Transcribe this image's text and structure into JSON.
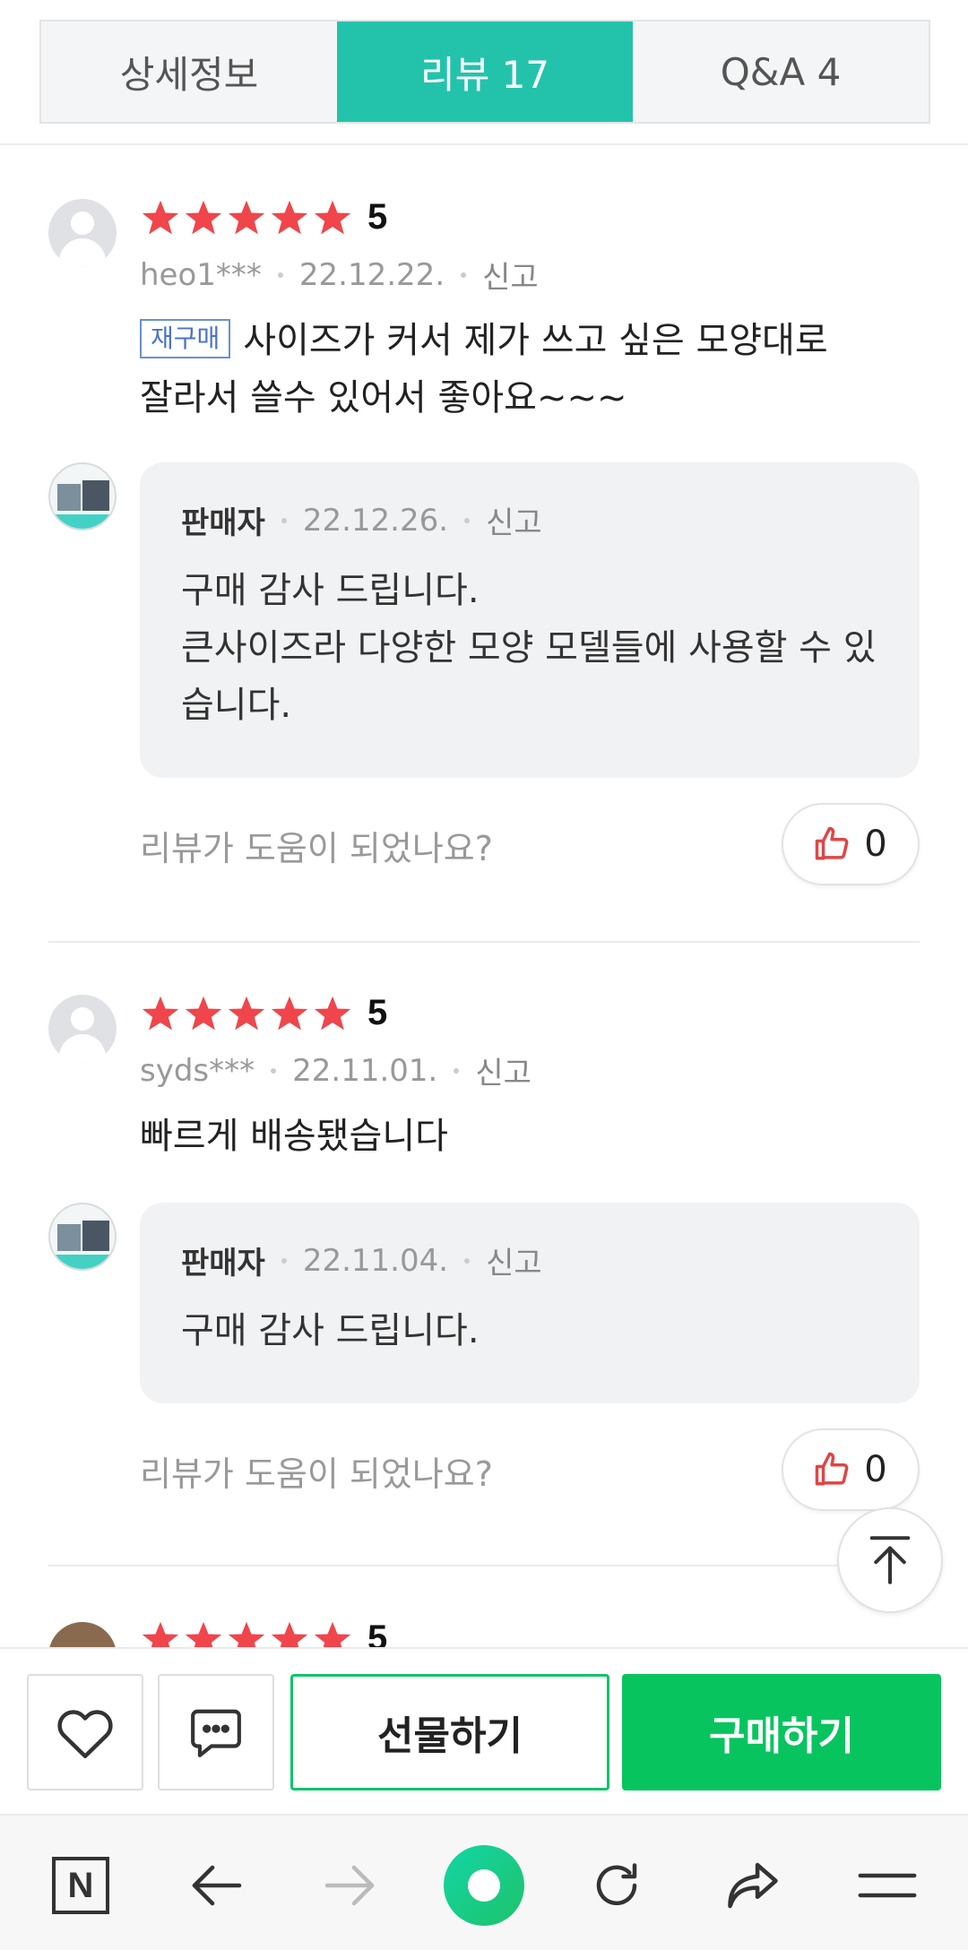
{
  "tabs": [
    {
      "label": "상세정보"
    },
    {
      "label": "리뷰  17"
    },
    {
      "label": "Q&A  4"
    }
  ],
  "reviews": [
    {
      "score": "5",
      "user": "heo1***",
      "date": "22.12.22.",
      "report": "신고",
      "badge": "재구매",
      "text_line1": "사이즈가 커서 제가 쓰고 싶은 모양대로",
      "text_line2": "잘라서 쓸수 있어서 좋아요~~~",
      "reply": {
        "seller": "판매자",
        "date": "22.12.26.",
        "report": "신고",
        "text": "구매 감사 드립니다.\n큰사이즈라 다양한 모양 모델들에 사용할 수 있습니다."
      },
      "helpful_prompt": "리뷰가 도움이 되었나요?",
      "likes": "0"
    },
    {
      "score": "5",
      "user": "syds***",
      "date": "22.11.01.",
      "report": "신고",
      "text": "빠르게 배송됐습니다",
      "reply": {
        "seller": "판매자",
        "date": "22.11.04.",
        "report": "신고",
        "text": "구매 감사 드립니다."
      },
      "helpful_prompt": "리뷰가 도움이 되었나요?",
      "likes": "0"
    },
    {
      "score": "5"
    }
  ],
  "buy_bar": {
    "gift_label": "선물하기",
    "buy_label": "구매하기"
  },
  "nav": {
    "n_logo": "N"
  },
  "colors": {
    "accent": "#23c3ab",
    "buy_green": "#07c45f",
    "star_red": "#f0454b"
  },
  "icons": [
    "heart-icon",
    "chat-icon",
    "thumbs-up-icon",
    "scroll-top-icon",
    "back-arrow-icon",
    "forward-arrow-icon",
    "reload-icon",
    "share-icon",
    "menu-icon"
  ]
}
